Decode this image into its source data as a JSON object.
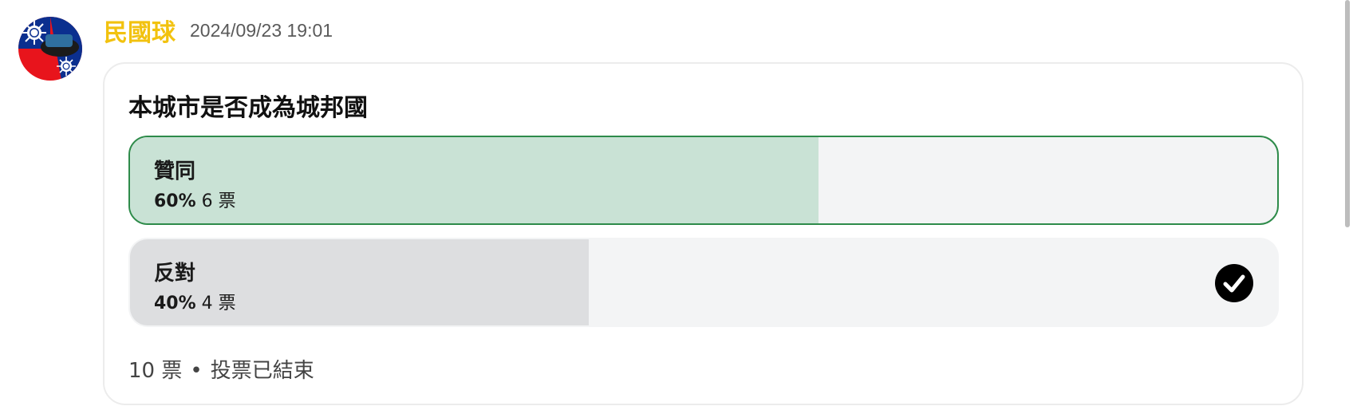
{
  "post": {
    "username": "民國球",
    "timestamp": "2024/09/23 19:01",
    "avatar_icon": "taiwan-flag-ball-avatar"
  },
  "poll": {
    "question": "本城市是否成為城邦國",
    "options": [
      {
        "label": "贊同",
        "percent_label": "60%",
        "votes_label": "6 票",
        "percent": 60,
        "fill_color": "#c9e2d5",
        "selected_border_color": "#2e8b4a",
        "highlighted": true
      },
      {
        "label": "反對",
        "percent_label": "40%",
        "votes_label": "4 票",
        "percent": 40,
        "fill_color": "#dddee0",
        "user_voted": true,
        "check_icon": "checkmark-circle-icon"
      }
    ],
    "total_votes_label": "10 票",
    "separator": "•",
    "status": "投票已結束"
  },
  "colors": {
    "username": "#f2c20f",
    "option_background": "#f3f4f5"
  }
}
